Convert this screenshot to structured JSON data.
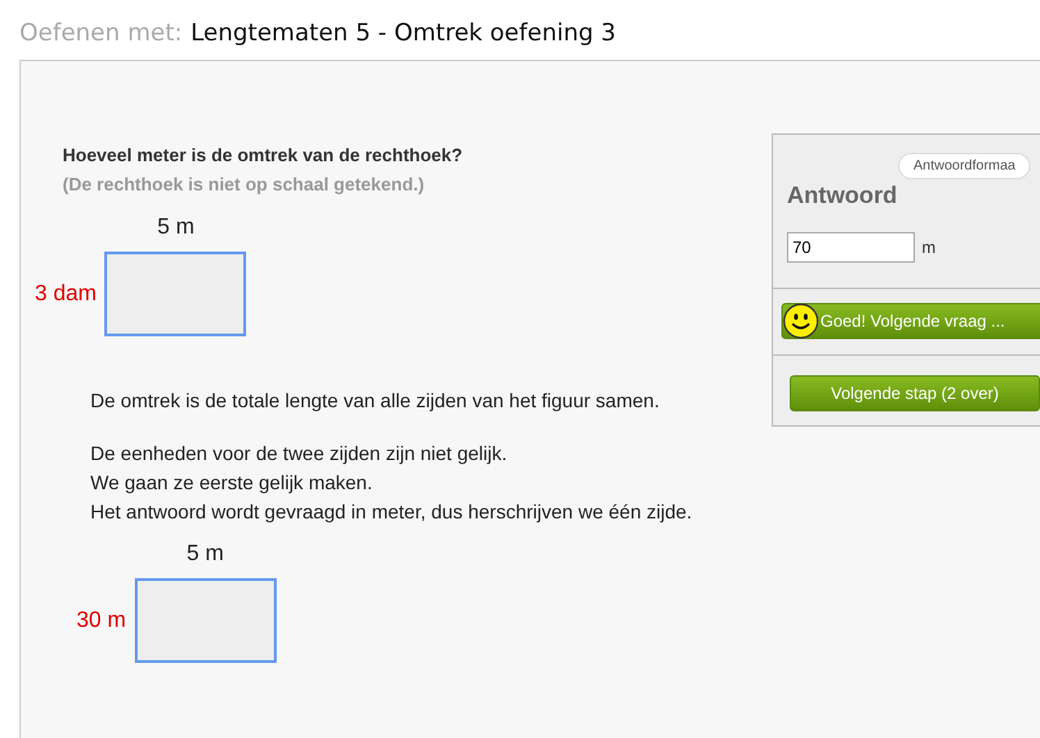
{
  "header": {
    "prefix": "Oefenen met:",
    "title": "Lengtematen 5 - Omtrek oefening 3"
  },
  "question": {
    "text": "Hoeveel meter is de omtrek van de rechthoek?",
    "note": "(De rechthoek is niet op schaal getekend.)"
  },
  "figures": [
    {
      "top_label": "5 m",
      "side_label": "3 dam"
    },
    {
      "top_label": "5 m",
      "side_label": "30 m"
    }
  ],
  "explanation": [
    {
      "lines": [
        "De omtrek is de totale lengte van alle zijden van het figuur samen."
      ]
    },
    {
      "lines": [
        "De eenheden voor de twee zijden zijn niet gelijk.",
        "We gaan ze eerste gelijk maken.",
        "Het antwoord wordt gevraagd in meter, dus herschrijven we één zijde."
      ]
    }
  ],
  "answer_panel": {
    "format_button": "Antwoordformaa",
    "title": "Antwoord",
    "value": "70",
    "unit": "m",
    "feedback_button": "Goed! Volgende vraag ...",
    "correct": true,
    "next_button": "Volgende stap (2 over)"
  }
}
